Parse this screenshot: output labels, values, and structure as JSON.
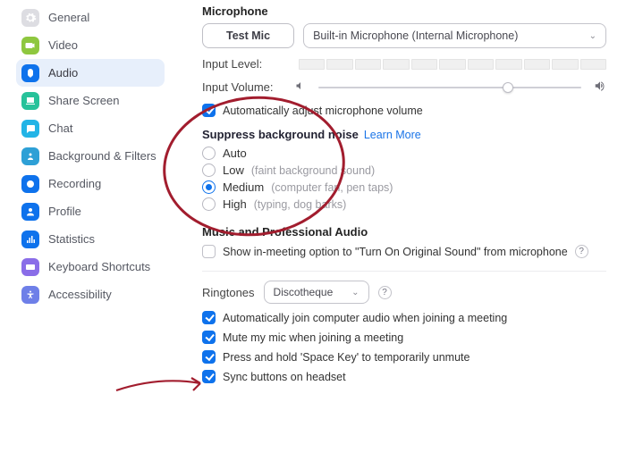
{
  "sidebar": {
    "items": [
      {
        "label": "General",
        "icon": "gear",
        "bg": "#dddde2",
        "fg": "#ffffff"
      },
      {
        "label": "Video",
        "icon": "video",
        "bg": "#8ec73f",
        "fg": "#ffffff"
      },
      {
        "label": "Audio",
        "icon": "audio",
        "bg": "#0e72ec",
        "fg": "#ffffff"
      },
      {
        "label": "Share Screen",
        "icon": "share",
        "bg": "#27c29a",
        "fg": "#ffffff"
      },
      {
        "label": "Chat",
        "icon": "chat",
        "bg": "#23b4e6",
        "fg": "#ffffff"
      },
      {
        "label": "Background & Filters",
        "icon": "bg",
        "bg": "#2ea0d6",
        "fg": "#ffffff"
      },
      {
        "label": "Recording",
        "icon": "rec",
        "bg": "#0e72ec",
        "fg": "#ffffff"
      },
      {
        "label": "Profile",
        "icon": "profile",
        "bg": "#0e72ec",
        "fg": "#ffffff"
      },
      {
        "label": "Statistics",
        "icon": "stats",
        "bg": "#0e72ec",
        "fg": "#ffffff"
      },
      {
        "label": "Keyboard Shortcuts",
        "icon": "keys",
        "bg": "#8a6de8",
        "fg": "#ffffff"
      },
      {
        "label": "Accessibility",
        "icon": "access",
        "bg": "#6e7fe8",
        "fg": "#ffffff"
      }
    ],
    "active_index": 2
  },
  "main": {
    "mic_section_title": "Microphone",
    "test_mic_label": "Test Mic",
    "mic_device": "Built-in Microphone (Internal Microphone)",
    "input_level_label": "Input Level:",
    "input_volume_label": "Input Volume:",
    "input_volume_pct": 72,
    "auto_adjust_label": "Automatically adjust microphone volume",
    "auto_adjust_checked": true,
    "noise": {
      "title": "Suppress background noise",
      "learn_more": "Learn More",
      "options": [
        {
          "label": "Auto",
          "hint": ""
        },
        {
          "label": "Low",
          "hint": "(faint background sound)"
        },
        {
          "label": "Medium",
          "hint": "(computer fan, pen taps)"
        },
        {
          "label": "High",
          "hint": "(typing, dog barks)"
        }
      ],
      "selected_index": 2
    },
    "music": {
      "title": "Music and Professional Audio",
      "original_sound_label": "Show in-meeting option to \"Turn On Original Sound\" from microphone",
      "original_sound_checked": false
    },
    "ringtones_label": "Ringtones",
    "ringtones_value": "Discotheque",
    "bottoms": [
      {
        "label": "Automatically join computer audio when joining a meeting",
        "checked": true
      },
      {
        "label": "Mute my mic when joining a meeting",
        "checked": true
      },
      {
        "label": "Press and hold 'Space Key' to temporarily unmute",
        "checked": true
      },
      {
        "label": "Sync buttons on headset",
        "checked": true
      }
    ]
  }
}
